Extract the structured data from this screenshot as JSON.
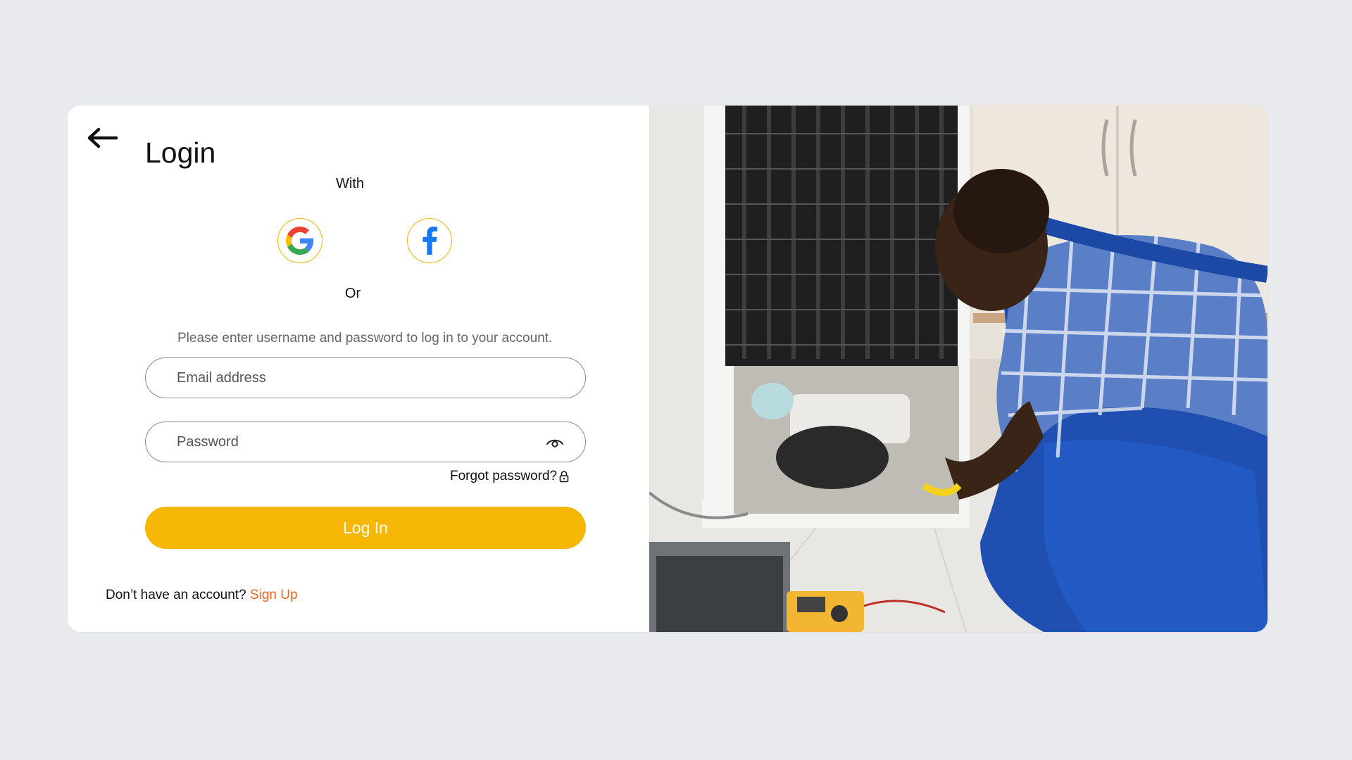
{
  "login": {
    "title": "Login",
    "with_label": "With",
    "or_label": "Or",
    "instructions": "Please enter username and password to log in to your account.",
    "email_placeholder": "Email address",
    "password_placeholder": "Password",
    "forgot_label": "Forgot password?",
    "login_button": "Log In",
    "signup_prompt": "Don’t have an account?",
    "signup_link": "Sign Up"
  },
  "icons": {
    "back": "arrow-left-icon",
    "google": "google-icon",
    "facebook": "facebook-icon",
    "eye": "eye-icon",
    "lock": "lock-icon"
  },
  "colors": {
    "background": "#e8eaed",
    "accent": "#f6b707",
    "social_border": "#f5b400",
    "link": "#f0641e",
    "facebook_blue": "#1877f2"
  }
}
